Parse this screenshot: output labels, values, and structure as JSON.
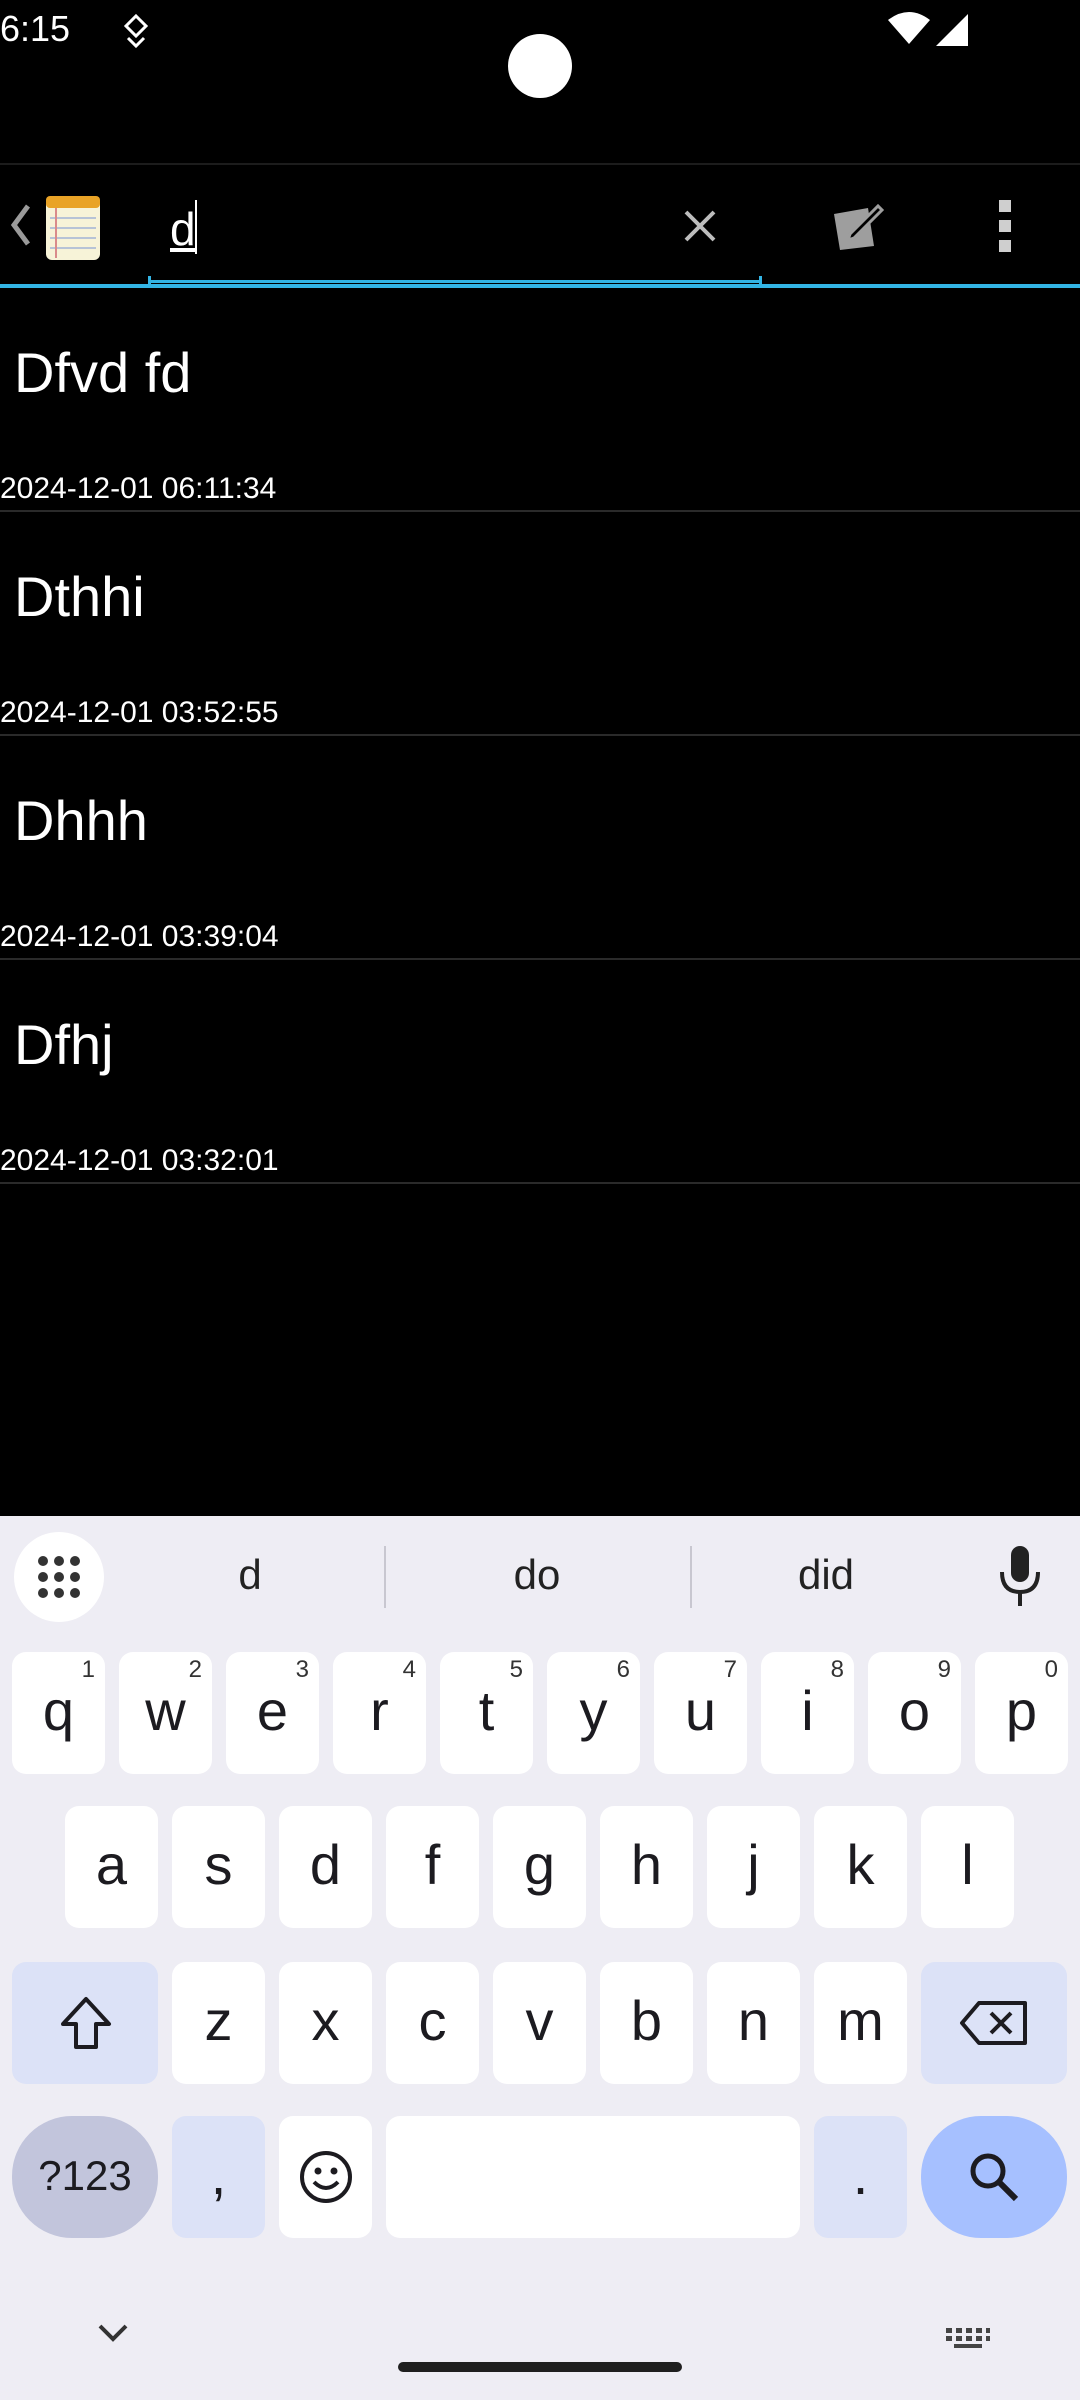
{
  "status_bar": {
    "time": "6:15"
  },
  "search": {
    "query": "d"
  },
  "notes": [
    {
      "title": "Dfvd fd",
      "date": "2024-12-01 06:11:34"
    },
    {
      "title": "Dthhi",
      "date": "2024-12-01 03:52:55"
    },
    {
      "title": "Dhhh",
      "date": "2024-12-01 03:39:04"
    },
    {
      "title": "Dfhj",
      "date": "2024-12-01 03:32:01"
    }
  ],
  "keyboard": {
    "suggestions": [
      "d",
      "do",
      "did"
    ],
    "row1": [
      {
        "ch": "q",
        "hint": "1"
      },
      {
        "ch": "w",
        "hint": "2"
      },
      {
        "ch": "e",
        "hint": "3"
      },
      {
        "ch": "r",
        "hint": "4"
      },
      {
        "ch": "t",
        "hint": "5"
      },
      {
        "ch": "y",
        "hint": "6"
      },
      {
        "ch": "u",
        "hint": "7"
      },
      {
        "ch": "i",
        "hint": "8"
      },
      {
        "ch": "o",
        "hint": "9"
      },
      {
        "ch": "p",
        "hint": "0"
      }
    ],
    "row2": [
      "a",
      "s",
      "d",
      "f",
      "g",
      "h",
      "j",
      "k",
      "l"
    ],
    "row3": [
      "z",
      "x",
      "c",
      "v",
      "b",
      "n",
      "m"
    ],
    "symbols_label": "?123",
    "comma": ",",
    "period": "."
  },
  "colors": {
    "accent": "#33b5e5",
    "keyboard_bg": "#eeedf4",
    "search_key": "#a6c0ff"
  }
}
